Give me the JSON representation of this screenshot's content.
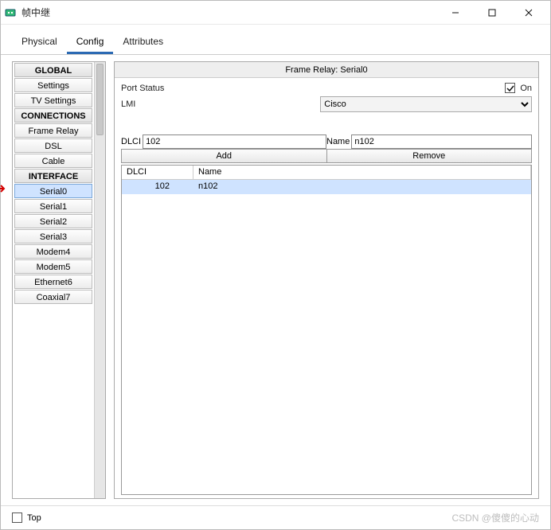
{
  "window": {
    "title": "帧中继"
  },
  "tabs": {
    "physical": "Physical",
    "config": "Config",
    "attributes": "Attributes",
    "active": "config"
  },
  "sidebar": {
    "items": [
      {
        "label": "GLOBAL",
        "kind": "header"
      },
      {
        "label": "Settings",
        "kind": "item"
      },
      {
        "label": "TV Settings",
        "kind": "item"
      },
      {
        "label": "CONNECTIONS",
        "kind": "header"
      },
      {
        "label": "Frame Relay",
        "kind": "item"
      },
      {
        "label": "DSL",
        "kind": "item"
      },
      {
        "label": "Cable",
        "kind": "item"
      },
      {
        "label": "INTERFACE",
        "kind": "header"
      },
      {
        "label": "Serial0",
        "kind": "item",
        "selected": true
      },
      {
        "label": "Serial1",
        "kind": "item"
      },
      {
        "label": "Serial2",
        "kind": "item"
      },
      {
        "label": "Serial3",
        "kind": "item"
      },
      {
        "label": "Modem4",
        "kind": "item"
      },
      {
        "label": "Modem5",
        "kind": "item"
      },
      {
        "label": "Ethernet6",
        "kind": "item"
      },
      {
        "label": "Coaxial7",
        "kind": "item"
      }
    ]
  },
  "panel": {
    "title": "Frame Relay: Serial0",
    "port_status_label": "Port Status",
    "port_status_value": "On",
    "port_status_checked": true,
    "lmi_label": "LMI",
    "lmi_value": "Cisco",
    "dlci_label": "DLCI",
    "dlci_value": "102",
    "name_label": "Name",
    "name_value": "n102",
    "add_btn": "Add",
    "remove_btn": "Remove",
    "columns": {
      "dlci": "DLCI",
      "name": "Name"
    },
    "rows": [
      {
        "dlci": "102",
        "name": "n102",
        "selected": true
      }
    ]
  },
  "footer": {
    "top_label": "Top",
    "top_checked": false,
    "watermark": "CSDN @傻傻的心动"
  }
}
